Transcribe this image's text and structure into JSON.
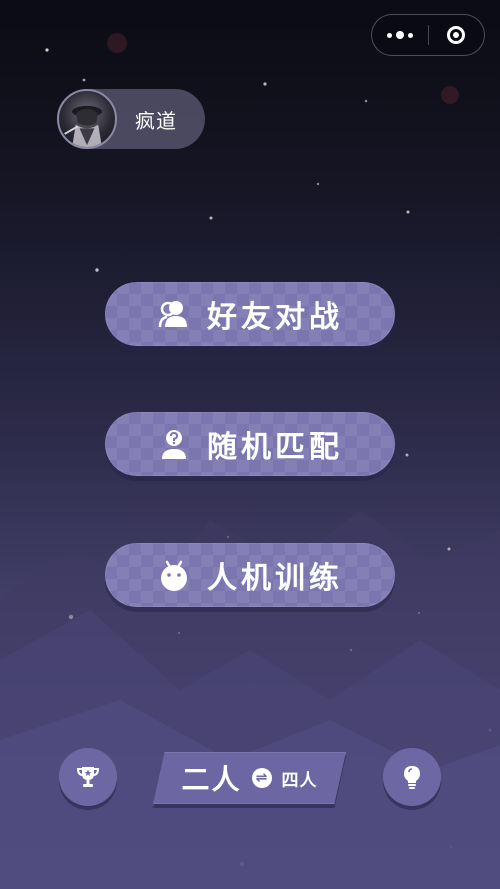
{
  "topbar": {
    "more_icon": "more-dots-icon",
    "close_icon": "target-circle-icon"
  },
  "profile": {
    "username": "疯道",
    "avatar_icon": "hooded-warrior-avatar"
  },
  "menu": {
    "friends_battle": {
      "label": "好友对战",
      "icon": "two-users-icon"
    },
    "random_match": {
      "label": "随机匹配",
      "icon": "user-question-icon"
    },
    "ai_training": {
      "label": "人机训练",
      "icon": "android-robot-icon"
    }
  },
  "bottom": {
    "rank_icon": "trophy-star-icon",
    "tips_icon": "lightbulb-icon",
    "player_toggle": {
      "current": "二人",
      "swap_symbol": "⇌",
      "alternate": "四人"
    }
  },
  "colors": {
    "button_purple": "#7b76b0",
    "round_button": "#6d68a3",
    "bg_top": "#0b0b12",
    "bg_bottom": "#5f5a92"
  }
}
